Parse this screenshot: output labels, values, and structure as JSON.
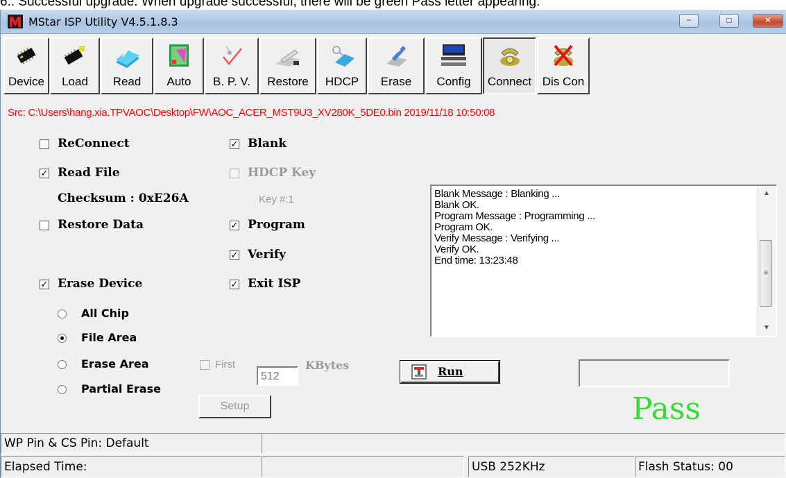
{
  "caption": "6.: Successful upgrade. When upgrade successful, there will be green Pass letter appearing.",
  "window": {
    "title": "MStar ISP Utility V4.5.1.8.3",
    "controls": {
      "minimize": "−",
      "maximize": "□",
      "close": "✕"
    }
  },
  "toolbar": [
    {
      "label": "Device",
      "icon": "device-chip-icon"
    },
    {
      "label": "Load",
      "icon": "load-chip-icon"
    },
    {
      "label": "Read",
      "icon": "read-icon"
    },
    {
      "label": "Auto",
      "icon": "auto-icon"
    },
    {
      "label": "B. P. V.",
      "icon": "bpv-check-icon"
    },
    {
      "label": "Restore",
      "icon": "restore-icon"
    },
    {
      "label": "HDCP",
      "icon": "hdcp-key-icon"
    },
    {
      "label": "Erase",
      "icon": "erase-icon"
    },
    {
      "label": "Config",
      "icon": "config-icon"
    },
    {
      "label": "Connect",
      "icon": "connect-phone-icon"
    },
    {
      "label": "Dis Con",
      "icon": "disconnect-icon"
    }
  ],
  "source_path": "Src: C:\\Users\\hang.xia.TPVAOC\\Desktop\\FW\\AOC_ACER_MST9U3_XV280K_5DE0.bin 2019/11/18 10:50:08",
  "options": {
    "reconnect": {
      "label": "ReConnect",
      "checked": false
    },
    "read_file": {
      "label": "Read File",
      "checked": true
    },
    "checksum": "Checksum : 0xE26A",
    "restore_data": {
      "label": "Restore Data",
      "checked": false
    },
    "erase_device": {
      "label": "Erase Device",
      "checked": true
    },
    "blank": {
      "label": "Blank",
      "checked": true
    },
    "hdcp_key": {
      "label": "HDCP Key",
      "checked": false,
      "disabled": true
    },
    "key_number": "Key #:1",
    "program": {
      "label": "Program",
      "checked": true
    },
    "verify": {
      "label": "Verify",
      "checked": true
    },
    "exit_isp": {
      "label": "Exit ISP",
      "checked": true
    }
  },
  "erase_modes": [
    {
      "label": "All Chip",
      "selected": false
    },
    {
      "label": "File Area",
      "selected": true
    },
    {
      "label": "Erase Area",
      "selected": false
    },
    {
      "label": "Partial Erase",
      "selected": false
    }
  ],
  "erase_area": {
    "first_label": "First",
    "first_value": "512",
    "unit": "KBytes"
  },
  "setup_label": "Setup",
  "run_label": "Run",
  "log_lines": [
    "Blank Message : Blanking ...",
    "Blank OK.",
    "Program Message : Programming ...",
    "Program OK.",
    "Verify Message : Verifying ...",
    "Verify OK.",
    "End time: 13:23:48"
  ],
  "result": {
    "text": "Pass",
    "color": "#33dd33"
  },
  "status": {
    "wp_pin": "WP Pin & CS Pin: Default",
    "elapsed": "Elapsed Time:",
    "usb": "USB  252KHz",
    "flash": "Flash Status: 00"
  }
}
